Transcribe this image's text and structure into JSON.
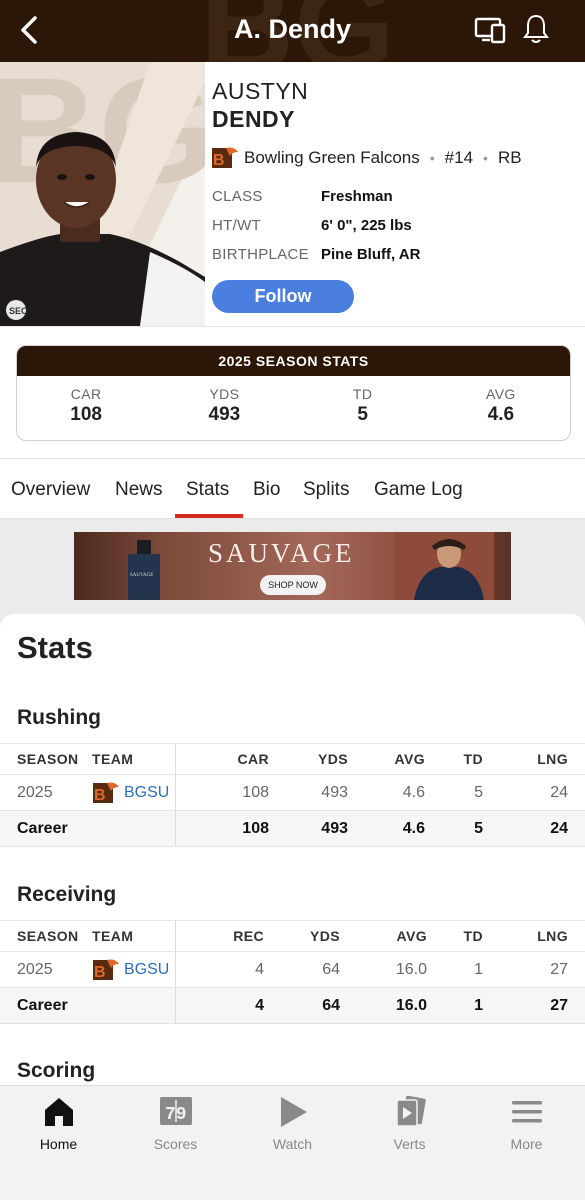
{
  "header": {
    "title": "A. Dendy"
  },
  "player": {
    "first_name": "AUSTYN",
    "last_name": "DENDY",
    "team": "Bowling Green Falcons",
    "number": "#14",
    "position": "RB",
    "bio": [
      {
        "label": "CLASS",
        "value": "Freshman"
      },
      {
        "label": "HT/WT",
        "value": "6' 0\", 225 lbs"
      },
      {
        "label": "BIRTHPLACE",
        "value": "Pine Bluff, AR"
      }
    ],
    "follow_label": "Follow"
  },
  "season_stats": {
    "title": "2025 SEASON STATS",
    "items": [
      {
        "label": "CAR",
        "value": "108"
      },
      {
        "label": "YDS",
        "value": "493"
      },
      {
        "label": "TD",
        "value": "5"
      },
      {
        "label": "AVG",
        "value": "4.6"
      }
    ]
  },
  "tabs": [
    "Overview",
    "News",
    "Stats",
    "Bio",
    "Splits",
    "Game Log"
  ],
  "active_tab": "Stats",
  "ad": {
    "brand": "SAUVAGE",
    "cta": "SHOP NOW",
    "bottle_label": "SAUVAGE"
  },
  "stats": {
    "heading": "Stats",
    "rushing": {
      "title": "Rushing",
      "columns": [
        "SEASON",
        "TEAM",
        "CAR",
        "YDS",
        "AVG",
        "TD",
        "LNG"
      ],
      "rows": [
        {
          "season": "2025",
          "team": "BGSU",
          "values": [
            "108",
            "493",
            "4.6",
            "5",
            "24"
          ]
        }
      ],
      "career": {
        "label": "Career",
        "values": [
          "108",
          "493",
          "4.6",
          "5",
          "24"
        ]
      }
    },
    "receiving": {
      "title": "Receiving",
      "columns": [
        "SEASON",
        "TEAM",
        "REC",
        "YDS",
        "AVG",
        "TD",
        "LNG"
      ],
      "rows": [
        {
          "season": "2025",
          "team": "BGSU",
          "values": [
            "4",
            "64",
            "16.0",
            "1",
            "27"
          ]
        }
      ],
      "career": {
        "label": "Career",
        "values": [
          "4",
          "64",
          "16.0",
          "1",
          "27"
        ]
      }
    },
    "scoring": {
      "title": "Scoring"
    }
  },
  "bottom_nav": [
    {
      "label": "Home",
      "icon": "home-icon",
      "active": true
    },
    {
      "label": "Scores",
      "icon": "scoreboard-icon",
      "active": false
    },
    {
      "label": "Watch",
      "icon": "play-icon",
      "active": false
    },
    {
      "label": "Verts",
      "icon": "verts-icon",
      "active": false
    },
    {
      "label": "More",
      "icon": "menu-icon",
      "active": false
    }
  ],
  "colors": {
    "brand_brown": "#2c1608",
    "accent_orange": "#e0672a",
    "follow_blue": "#4a7fe0",
    "tab_red": "#d42c1f",
    "link_blue": "#2f6fb7"
  }
}
